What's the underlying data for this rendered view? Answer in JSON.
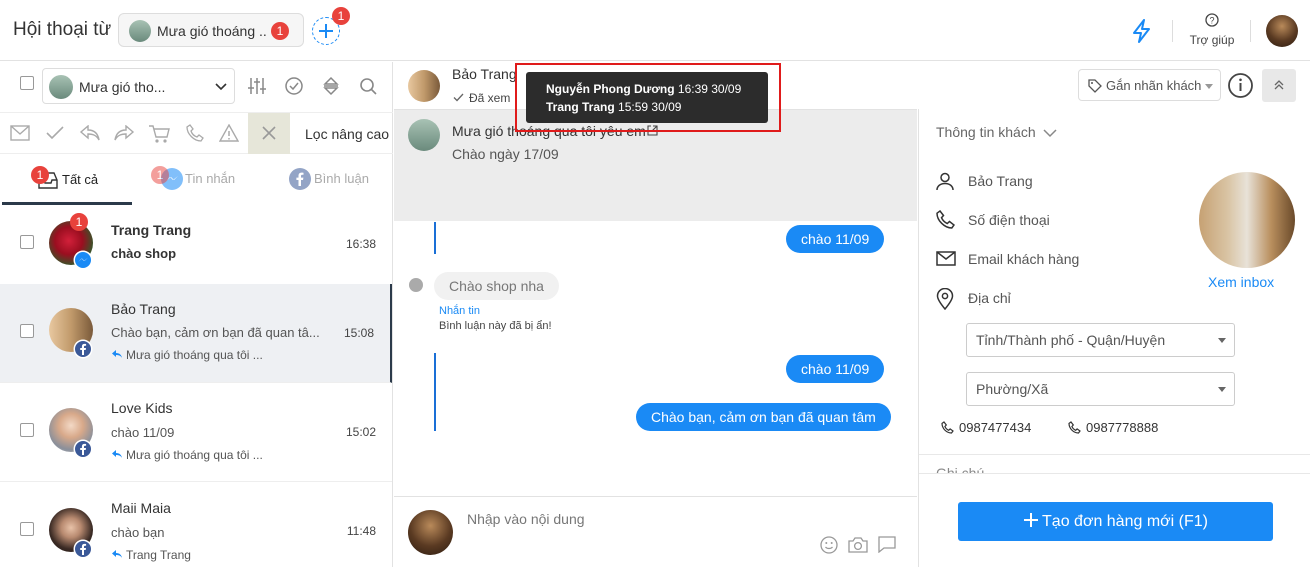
{
  "header": {
    "title": "Hội thoại từ",
    "page_chip_label": "Mưa gió thoáng ..",
    "page_chip_badge": "1",
    "add_page_badge": "1",
    "help_label": "Trợ giúp"
  },
  "left": {
    "page_select": "Mưa gió tho...",
    "advanced_filter": "Lọc nâng cao",
    "tabs": [
      {
        "label": "Tất cả",
        "badge": "1"
      },
      {
        "label": "Tin nhắn",
        "badge": "1"
      },
      {
        "label": "Bình luận"
      }
    ],
    "conversations": [
      {
        "name": "Trang Trang",
        "message": "chào shop",
        "time": "16:38",
        "badge": "1",
        "channel": "messenger-icon"
      },
      {
        "name": "Bảo Trang",
        "message": "Chào bạn, cảm ơn bạn đã quan tâ...",
        "time": "15:08",
        "context": "Mưa gió thoáng qua tôi ...",
        "channel": "facebook-icon"
      },
      {
        "name": "Love Kids",
        "message": "chào 11/09",
        "time": "15:02",
        "context": "Mưa gió thoáng qua tôi ...",
        "channel": "facebook-icon"
      },
      {
        "name": "Maii Maia",
        "message": "chào bạn",
        "time": "11:48",
        "context": "Trang Trang",
        "channel": "facebook-icon"
      }
    ]
  },
  "chat": {
    "contact_name": "Bảo Trang",
    "seen_label": "Đã xem",
    "tooltip": [
      {
        "name": "Nguyễn Phong Dương",
        "time": "16:39 30/09"
      },
      {
        "name": "Trang Trang",
        "time": "15:59 30/09"
      }
    ],
    "tag_button": "Gắn nhãn khách",
    "post_title": "Mưa gió thoáng qua tôi yêu em",
    "post_sub": "Chào ngày 17/09",
    "messages": {
      "out1": "chào 11/09",
      "in_comment": "Chào shop nha",
      "reply_link": "Nhắn tin",
      "hidden_note": "Bình luận này đã bị ẩn!",
      "out2": "chào 11/09",
      "out3": "Chào bạn, cảm ơn bạn đã quan tâm"
    },
    "input_placeholder": "Nhập vào nội dung"
  },
  "customer": {
    "section_title": "Thông tin khách",
    "name": "Bảo Trang",
    "phone_label": "Số điện thoại",
    "email_label": "Email khách hàng",
    "address_label": "Địa chỉ",
    "province_placeholder": "Tỉnh/Thành phố - Quận/Huyện",
    "ward_placeholder": "Phường/Xã",
    "phones": [
      "0987477434",
      "0987778888"
    ],
    "view_inbox": "Xem inbox",
    "next_section_partial": "Ghi chú",
    "create_order_button": "Tạo đơn hàng mới (F1)"
  },
  "colors": {
    "accent": "#1a8af5",
    "badge": "#e8423c",
    "highlight_box": "#e01b1b"
  }
}
